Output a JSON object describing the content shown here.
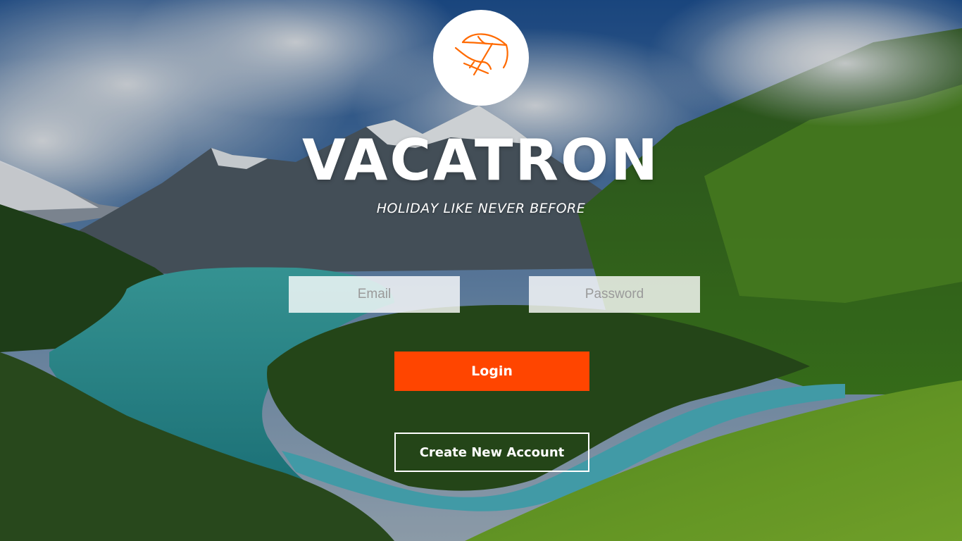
{
  "app": {
    "name": "VACATRON",
    "tagline": "HOLIDAY LIKE NEVER BEFORE",
    "logo_icon": "beach-umbrella-icon"
  },
  "form": {
    "email_placeholder": "Email",
    "password_placeholder": "Password",
    "login_label": "Login",
    "create_account_label": "Create New Account"
  },
  "colors": {
    "accent": "#ff4500",
    "logo_stroke": "#ff6a00",
    "text": "#ffffff"
  },
  "background": {
    "scene": "mountain-valley-lake"
  }
}
